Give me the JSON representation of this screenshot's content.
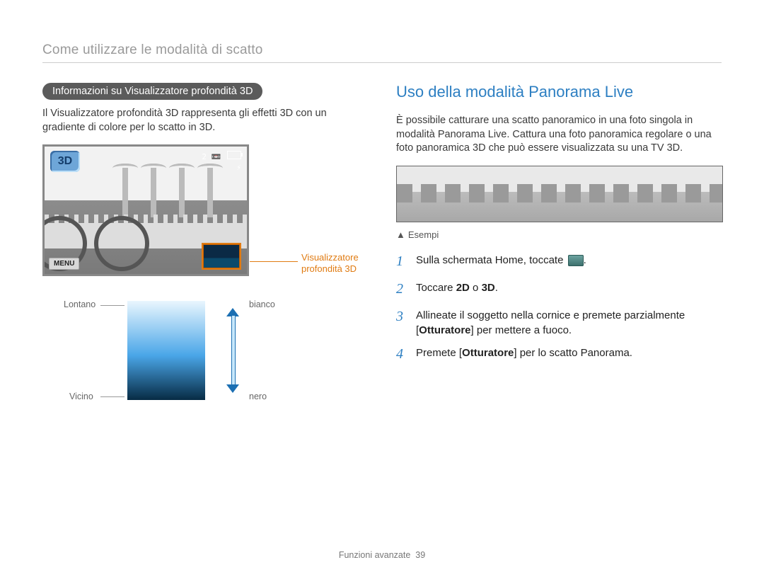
{
  "breadcrumb": "Come utilizzare le modalità di scatto",
  "left": {
    "pill": "Informazioni su Visualizzatore profondità 3D",
    "intro": "Il Visualizzatore profondità 3D rappresenta gli effetti 3D con un gradiente di colore per lo scatto in 3D.",
    "screen": {
      "badge": "3D",
      "osd_count": "2",
      "menu": "MENU"
    },
    "callout": {
      "line1": "Visualizzatore",
      "line2": "profondità 3D"
    },
    "legend": {
      "far": "Lontano",
      "near": "Vicino",
      "white": "bianco",
      "black": "nero"
    }
  },
  "right": {
    "heading": "Uso della modalità Panorama Live",
    "intro": "È possibile catturare una scatto panoramico in una foto singola in modalità Panorama Live. Cattura una foto panoramica regolare o una foto panoramica 3D che può essere visualizzata su una TV 3D.",
    "esempi": "Esempi",
    "steps": {
      "s1": "Sulla schermata Home, toccate",
      "s1_suffix": ".",
      "s2_pre": "Toccare ",
      "s2_b1": "2D",
      "s2_mid": " o ",
      "s2_b2": "3D",
      "s2_suf": ".",
      "s3_pre": "Allineate il soggetto nella cornice e premete parzialmente [",
      "s3_b": "Otturatore",
      "s3_suf": "] per mettere a fuoco.",
      "s4_pre": "Premete [",
      "s4_b": "Otturatore",
      "s4_suf": "] per lo scatto Panorama."
    }
  },
  "footer": {
    "label": "Funzioni avanzate",
    "page": "39"
  }
}
